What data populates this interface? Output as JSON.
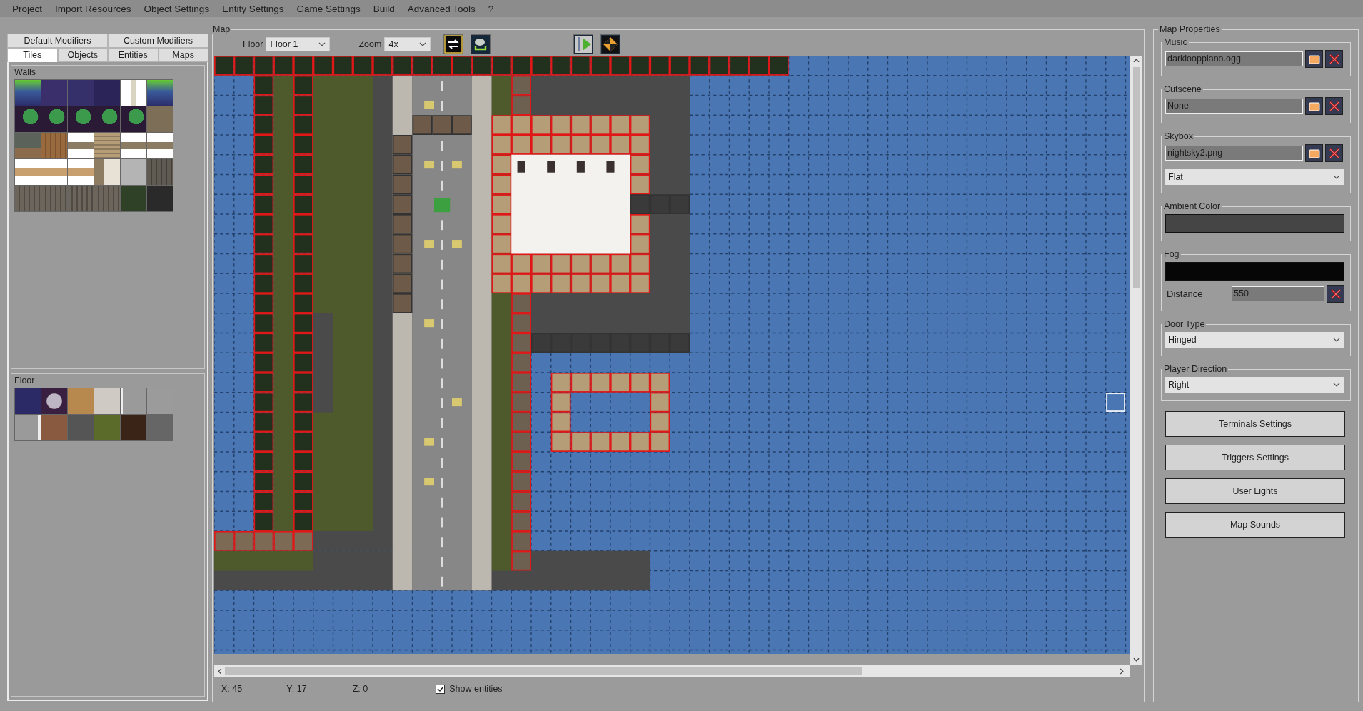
{
  "menu": [
    "Project",
    "Import Resources",
    "Object Settings",
    "Entity Settings",
    "Game Settings",
    "Build",
    "Advanced Tools",
    "?"
  ],
  "left_panel": {
    "tabs_row1": [
      {
        "label": "Default Modifiers",
        "selected": false
      },
      {
        "label": "Custom Modifiers",
        "selected": false
      }
    ],
    "tabs_row2": [
      {
        "label": "Tiles",
        "selected": true
      },
      {
        "label": "Objects",
        "selected": false
      },
      {
        "label": "Entities",
        "selected": false
      },
      {
        "label": "Maps",
        "selected": false
      }
    ],
    "groups": [
      {
        "title": "Walls"
      },
      {
        "title": "Floor"
      }
    ]
  },
  "map": {
    "title": "Map",
    "floor_label": "Floor",
    "floor_value": "Floor 1",
    "zoom_label": "Zoom",
    "zoom_value": "4x"
  },
  "status_bar": {
    "x": "X: 45",
    "y": "Y: 17",
    "z": "Z: 0",
    "show_entities": {
      "label": "Show entities",
      "checked": true
    }
  },
  "properties": {
    "title": "Map Properties",
    "sections": [
      {
        "title": "Music",
        "fields": [
          {
            "kind": "file",
            "value": "darklooppiano.ogg"
          }
        ]
      },
      {
        "title": "Cutscene",
        "fields": [
          {
            "kind": "file",
            "value": "None"
          }
        ]
      },
      {
        "title": "Skybox",
        "fields": [
          {
            "kind": "file",
            "value": "nightsky2.png"
          },
          {
            "kind": "select",
            "value": "Flat"
          }
        ]
      },
      {
        "title": "Ambient Color",
        "fields": [
          {
            "kind": "color",
            "color": "#454545"
          }
        ]
      },
      {
        "title": "Fog",
        "fields": [
          {
            "kind": "color",
            "color": "#060606"
          },
          {
            "kind": "number",
            "label": "Distance",
            "value": "550"
          }
        ]
      },
      {
        "title": "Door Type",
        "fields": [
          {
            "kind": "select",
            "value": "Hinged"
          }
        ]
      },
      {
        "title": "Player Direction",
        "fields": [
          {
            "kind": "select",
            "value": "Right"
          }
        ]
      }
    ],
    "buttons": [
      "Terminals Settings",
      "Triggers Settings",
      "User Lights",
      "Map Sounds"
    ]
  }
}
